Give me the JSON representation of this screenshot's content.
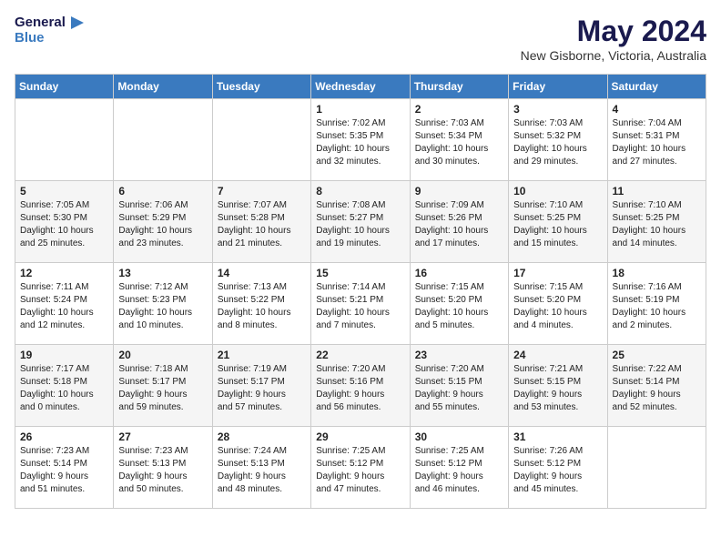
{
  "header": {
    "logo_line1": "General",
    "logo_line2": "Blue",
    "month": "May 2024",
    "location": "New Gisborne, Victoria, Australia"
  },
  "weekdays": [
    "Sunday",
    "Monday",
    "Tuesday",
    "Wednesday",
    "Thursday",
    "Friday",
    "Saturday"
  ],
  "weeks": [
    [
      {
        "day": "",
        "info": ""
      },
      {
        "day": "",
        "info": ""
      },
      {
        "day": "",
        "info": ""
      },
      {
        "day": "1",
        "info": "Sunrise: 7:02 AM\nSunset: 5:35 PM\nDaylight: 10 hours\nand 32 minutes."
      },
      {
        "day": "2",
        "info": "Sunrise: 7:03 AM\nSunset: 5:34 PM\nDaylight: 10 hours\nand 30 minutes."
      },
      {
        "day": "3",
        "info": "Sunrise: 7:03 AM\nSunset: 5:32 PM\nDaylight: 10 hours\nand 29 minutes."
      },
      {
        "day": "4",
        "info": "Sunrise: 7:04 AM\nSunset: 5:31 PM\nDaylight: 10 hours\nand 27 minutes."
      }
    ],
    [
      {
        "day": "5",
        "info": "Sunrise: 7:05 AM\nSunset: 5:30 PM\nDaylight: 10 hours\nand 25 minutes."
      },
      {
        "day": "6",
        "info": "Sunrise: 7:06 AM\nSunset: 5:29 PM\nDaylight: 10 hours\nand 23 minutes."
      },
      {
        "day": "7",
        "info": "Sunrise: 7:07 AM\nSunset: 5:28 PM\nDaylight: 10 hours\nand 21 minutes."
      },
      {
        "day": "8",
        "info": "Sunrise: 7:08 AM\nSunset: 5:27 PM\nDaylight: 10 hours\nand 19 minutes."
      },
      {
        "day": "9",
        "info": "Sunrise: 7:09 AM\nSunset: 5:26 PM\nDaylight: 10 hours\nand 17 minutes."
      },
      {
        "day": "10",
        "info": "Sunrise: 7:10 AM\nSunset: 5:25 PM\nDaylight: 10 hours\nand 15 minutes."
      },
      {
        "day": "11",
        "info": "Sunrise: 7:10 AM\nSunset: 5:25 PM\nDaylight: 10 hours\nand 14 minutes."
      }
    ],
    [
      {
        "day": "12",
        "info": "Sunrise: 7:11 AM\nSunset: 5:24 PM\nDaylight: 10 hours\nand 12 minutes."
      },
      {
        "day": "13",
        "info": "Sunrise: 7:12 AM\nSunset: 5:23 PM\nDaylight: 10 hours\nand 10 minutes."
      },
      {
        "day": "14",
        "info": "Sunrise: 7:13 AM\nSunset: 5:22 PM\nDaylight: 10 hours\nand 8 minutes."
      },
      {
        "day": "15",
        "info": "Sunrise: 7:14 AM\nSunset: 5:21 PM\nDaylight: 10 hours\nand 7 minutes."
      },
      {
        "day": "16",
        "info": "Sunrise: 7:15 AM\nSunset: 5:20 PM\nDaylight: 10 hours\nand 5 minutes."
      },
      {
        "day": "17",
        "info": "Sunrise: 7:15 AM\nSunset: 5:20 PM\nDaylight: 10 hours\nand 4 minutes."
      },
      {
        "day": "18",
        "info": "Sunrise: 7:16 AM\nSunset: 5:19 PM\nDaylight: 10 hours\nand 2 minutes."
      }
    ],
    [
      {
        "day": "19",
        "info": "Sunrise: 7:17 AM\nSunset: 5:18 PM\nDaylight: 10 hours\nand 0 minutes."
      },
      {
        "day": "20",
        "info": "Sunrise: 7:18 AM\nSunset: 5:17 PM\nDaylight: 9 hours\nand 59 minutes."
      },
      {
        "day": "21",
        "info": "Sunrise: 7:19 AM\nSunset: 5:17 PM\nDaylight: 9 hours\nand 57 minutes."
      },
      {
        "day": "22",
        "info": "Sunrise: 7:20 AM\nSunset: 5:16 PM\nDaylight: 9 hours\nand 56 minutes."
      },
      {
        "day": "23",
        "info": "Sunrise: 7:20 AM\nSunset: 5:15 PM\nDaylight: 9 hours\nand 55 minutes."
      },
      {
        "day": "24",
        "info": "Sunrise: 7:21 AM\nSunset: 5:15 PM\nDaylight: 9 hours\nand 53 minutes."
      },
      {
        "day": "25",
        "info": "Sunrise: 7:22 AM\nSunset: 5:14 PM\nDaylight: 9 hours\nand 52 minutes."
      }
    ],
    [
      {
        "day": "26",
        "info": "Sunrise: 7:23 AM\nSunset: 5:14 PM\nDaylight: 9 hours\nand 51 minutes."
      },
      {
        "day": "27",
        "info": "Sunrise: 7:23 AM\nSunset: 5:13 PM\nDaylight: 9 hours\nand 50 minutes."
      },
      {
        "day": "28",
        "info": "Sunrise: 7:24 AM\nSunset: 5:13 PM\nDaylight: 9 hours\nand 48 minutes."
      },
      {
        "day": "29",
        "info": "Sunrise: 7:25 AM\nSunset: 5:12 PM\nDaylight: 9 hours\nand 47 minutes."
      },
      {
        "day": "30",
        "info": "Sunrise: 7:25 AM\nSunset: 5:12 PM\nDaylight: 9 hours\nand 46 minutes."
      },
      {
        "day": "31",
        "info": "Sunrise: 7:26 AM\nSunset: 5:12 PM\nDaylight: 9 hours\nand 45 minutes."
      },
      {
        "day": "",
        "info": ""
      }
    ]
  ]
}
